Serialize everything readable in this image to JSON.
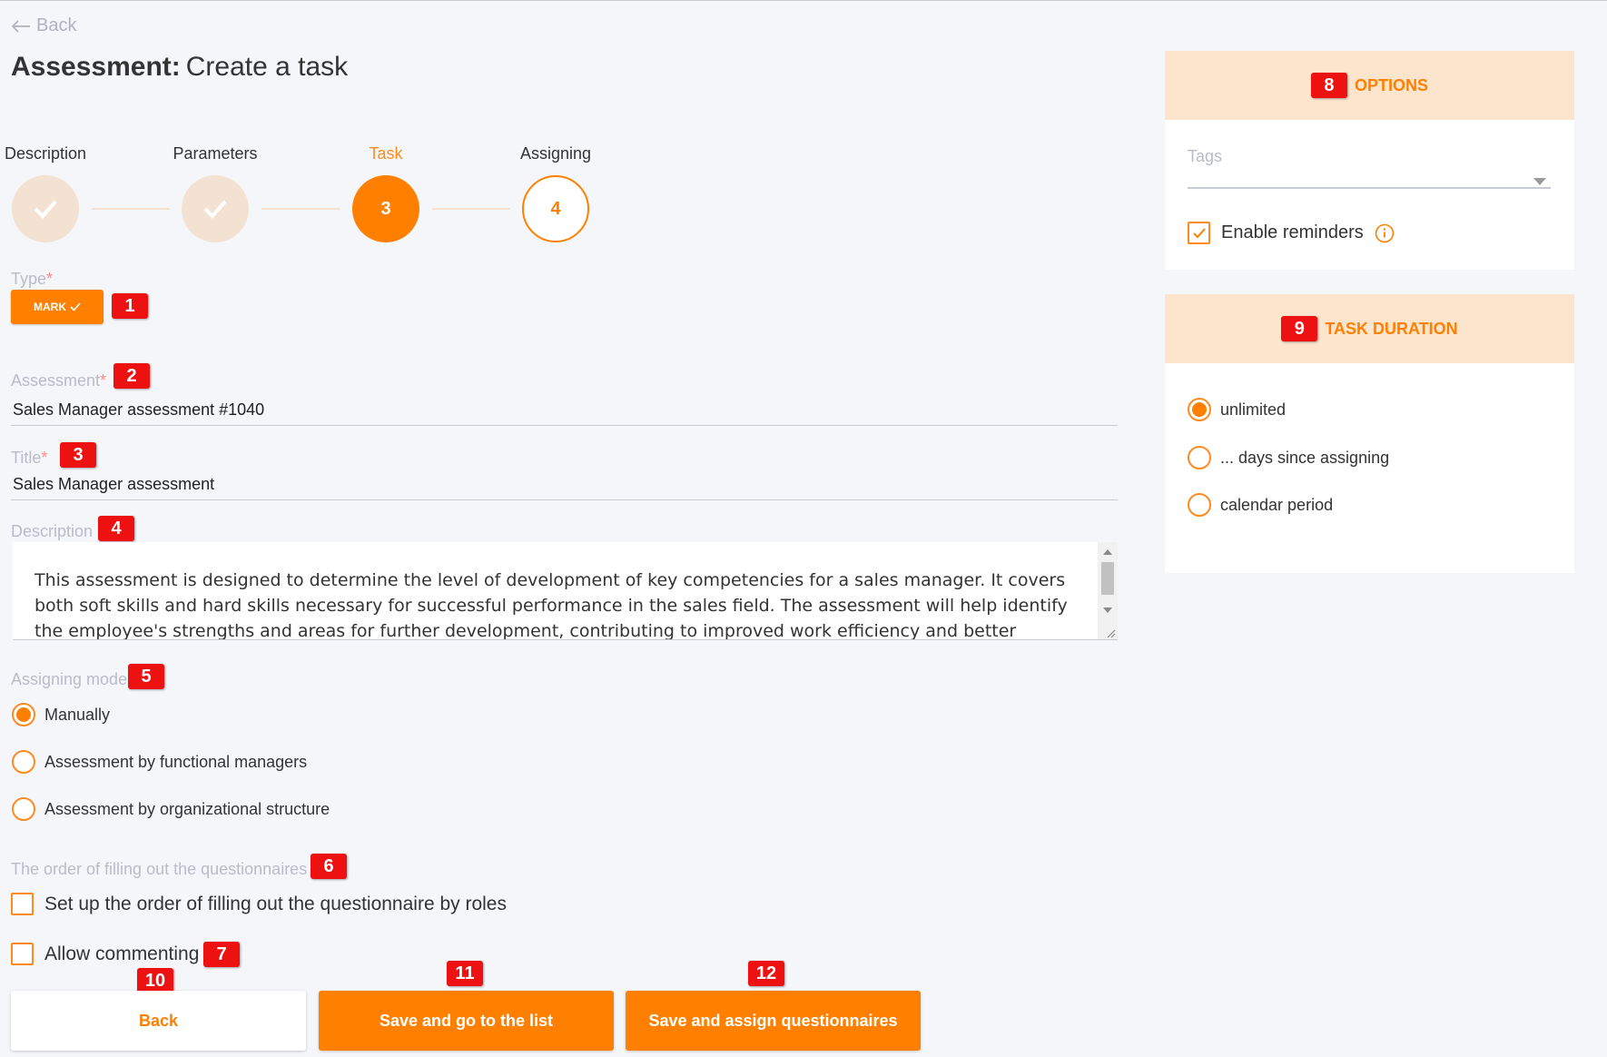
{
  "nav": {
    "back_label": "Back"
  },
  "header": {
    "title_bold": "Assessment:",
    "title_sub": "Create a task"
  },
  "stepper": {
    "steps": [
      {
        "label": "Description",
        "state": "done",
        "number": ""
      },
      {
        "label": "Parameters",
        "state": "done",
        "number": ""
      },
      {
        "label": "Task",
        "state": "active",
        "number": "3"
      },
      {
        "label": "Assigning",
        "state": "upcoming",
        "number": "4"
      }
    ]
  },
  "type_field": {
    "label": "Type",
    "required_mark": "*",
    "button_label": "MARK",
    "badge": "1"
  },
  "assessment_field": {
    "label": "Assessment",
    "required_mark": "*",
    "value": "Sales Manager assessment #1040",
    "badge": "2"
  },
  "title_field": {
    "label": "Title",
    "required_mark": "*",
    "value": "Sales Manager assessment",
    "badge": "3"
  },
  "description_field": {
    "label": "Description",
    "badge": "4",
    "value": "This assessment is designed to determine the level of development of key competencies for a sales manager. It covers both soft skills and hard skills necessary for successful performance in the sales field. The assessment will help identify the employee's strengths and areas for further development, contributing to improved work efficiency and better results."
  },
  "assigning_mode": {
    "label": "Assigning mode",
    "badge": "5",
    "options": [
      {
        "label": "Manually",
        "selected": true
      },
      {
        "label": "Assessment by functional managers",
        "selected": false
      },
      {
        "label": "Assessment by organizational structure",
        "selected": false
      }
    ]
  },
  "order_section": {
    "label": "The order of filling out the questionnaires",
    "badge": "6",
    "checkbox_label": "Set up the order of filling out the questionnaire by roles"
  },
  "commenting": {
    "label": "Allow commenting",
    "badge": "7",
    "checked": false
  },
  "actions": {
    "back": {
      "label": "Back",
      "badge": "10"
    },
    "save_list": {
      "label": "Save and go to the list",
      "badge": "11"
    },
    "save_assign": {
      "label": "Save and assign questionnaires",
      "badge": "12"
    }
  },
  "options_panel": {
    "title": "OPTIONS",
    "badge": "8",
    "tags_placeholder": "Tags",
    "reminders_label": "Enable reminders",
    "reminders_checked": true
  },
  "duration_panel": {
    "title": "TASK DURATION",
    "badge": "9",
    "options": [
      {
        "label": "unlimited",
        "selected": true
      },
      {
        "label": "... days since assigning",
        "selected": false
      },
      {
        "label": "calendar period",
        "selected": false
      }
    ]
  },
  "colors": {
    "accent": "#ff8000",
    "accent_light": "#fde5cd",
    "badge": "#ee1111",
    "muted_label": "#b9bcc6"
  }
}
